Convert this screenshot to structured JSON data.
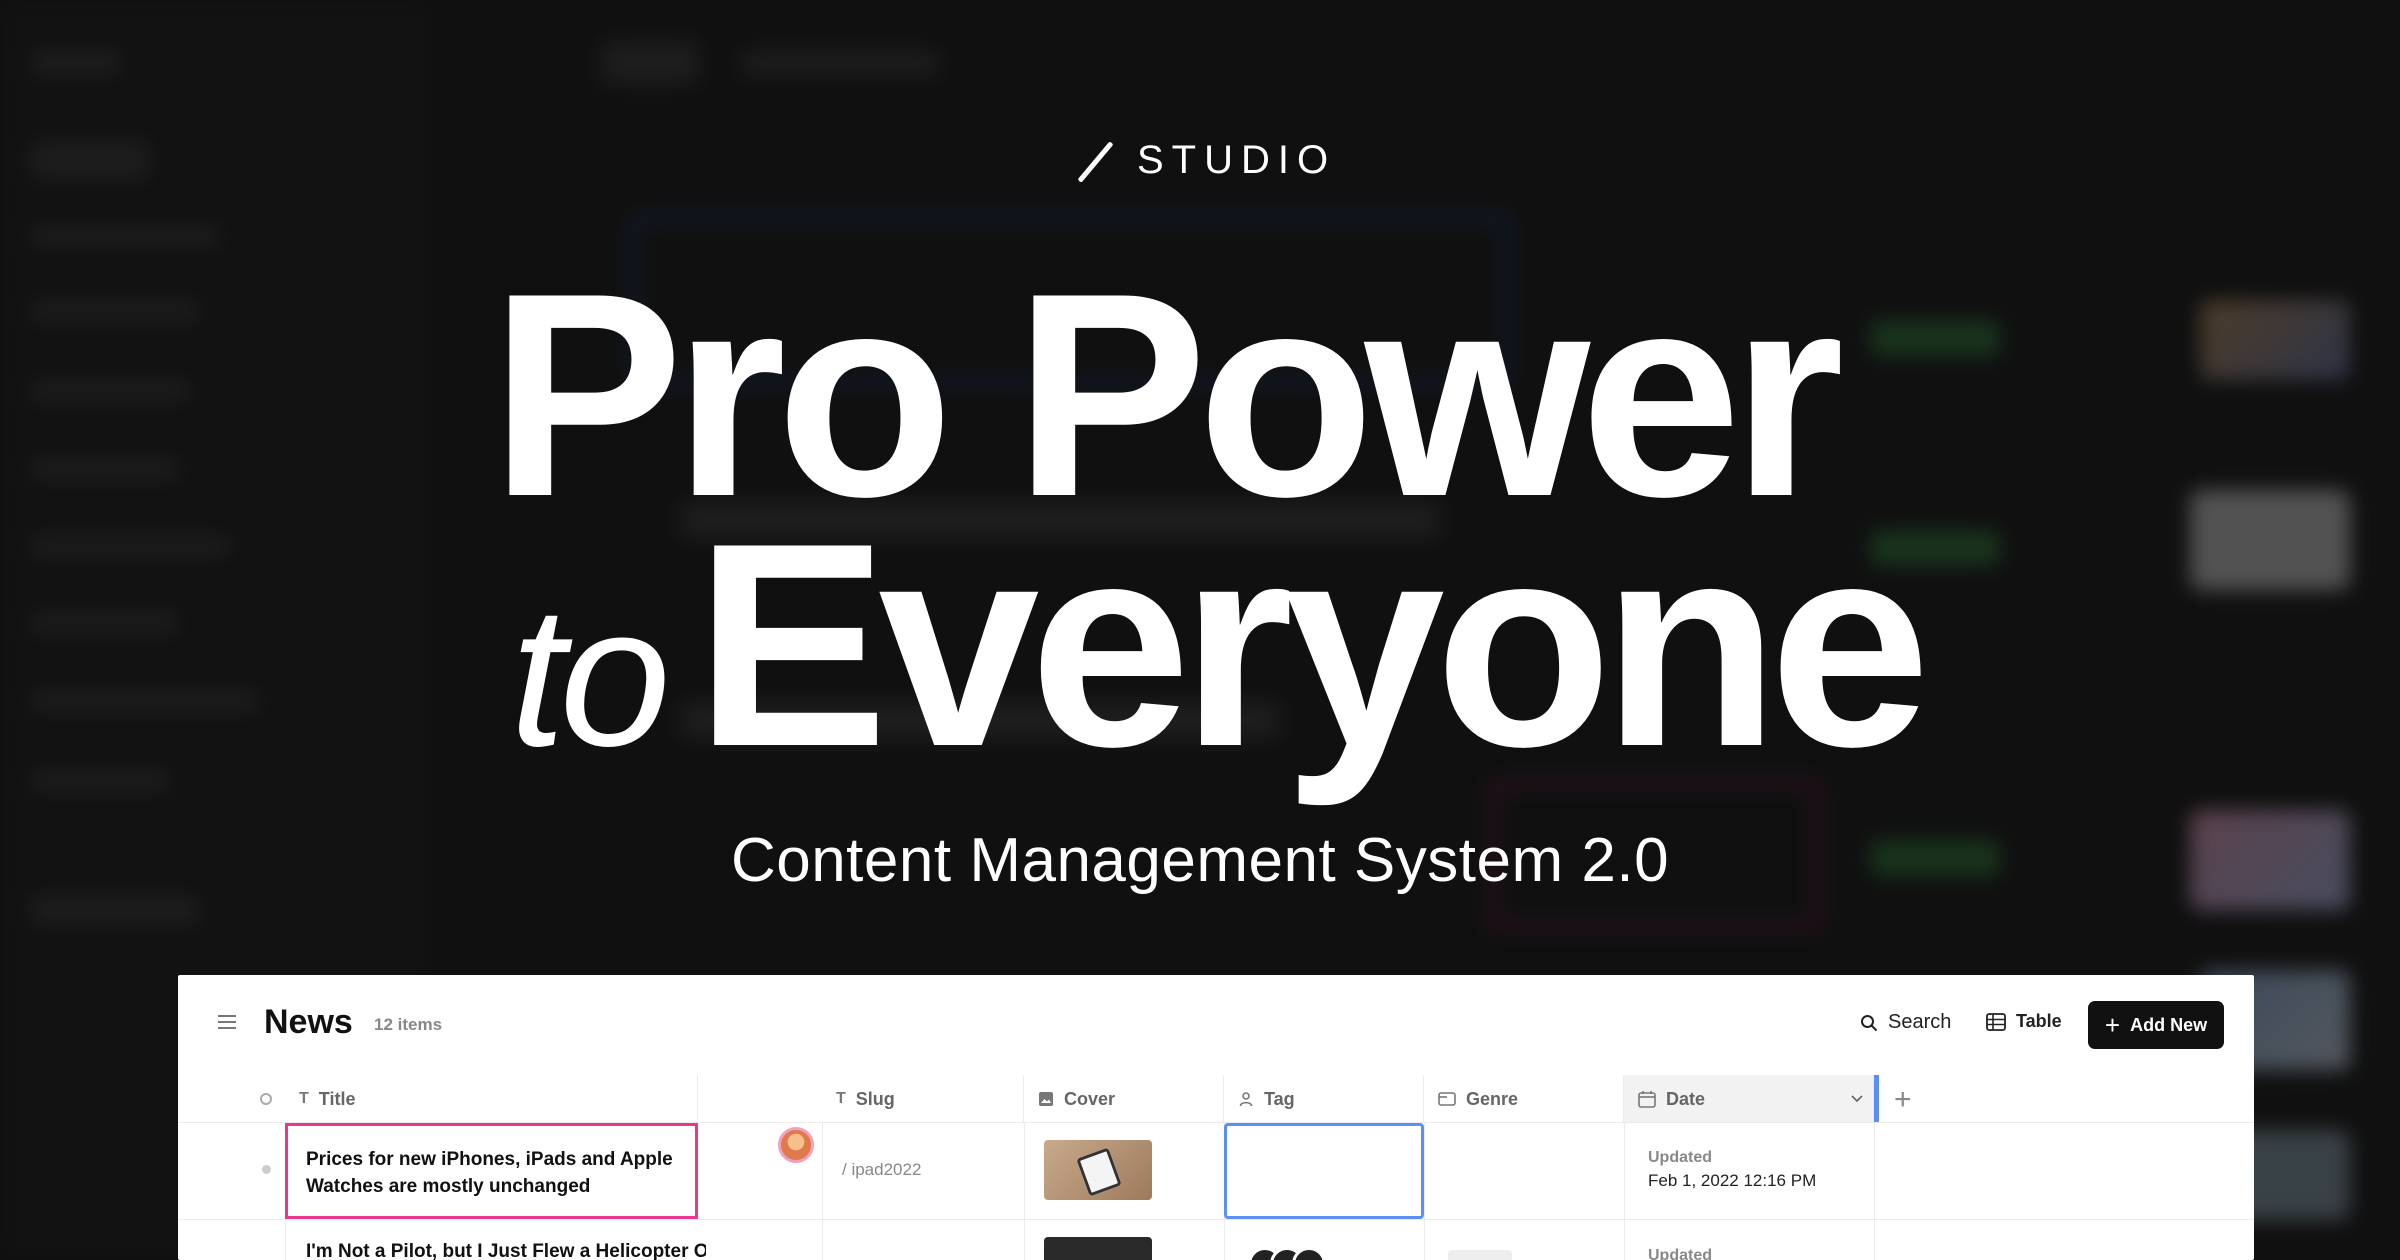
{
  "hero": {
    "brand": "STUDIO",
    "line1": "Pro Power",
    "line2_prefix": "to",
    "line2_main": "Everyone",
    "subtitle": "Content Management System 2.0"
  },
  "cms": {
    "title": "News",
    "item_count": "12 items",
    "toolbar": {
      "search_label": "Search",
      "table_label": "Table",
      "add_label": "Add New"
    },
    "columns": [
      {
        "label": "Title",
        "icon": "text-icon"
      },
      {
        "label": "Slug",
        "icon": "text-icon"
      },
      {
        "label": "Cover",
        "icon": "image-icon"
      },
      {
        "label": "Tag",
        "icon": "person-icon"
      },
      {
        "label": "Genre",
        "icon": "folder-icon"
      },
      {
        "label": "Date",
        "icon": "calendar-icon"
      }
    ],
    "rows": [
      {
        "title": "Prices for new iPhones, iPads and Apple Watches are mostly unchanged",
        "slug": "/ ipad2022",
        "date_label": "Updated",
        "date_value": "Feb 1, 2022 12:16 PM"
      },
      {
        "title": "I'm Not a Pilot, but I Just Flew a Helicopter Over California",
        "date_label": "Updated"
      }
    ]
  },
  "colors": {
    "accent_blue": "#5b8ff5",
    "accent_pink": "#e6398d",
    "button_dark": "#111111"
  }
}
